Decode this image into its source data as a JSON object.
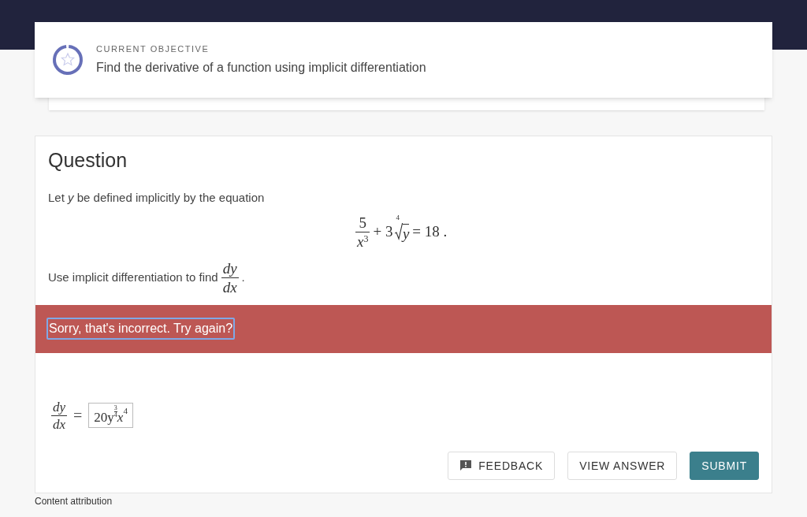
{
  "objective": {
    "label": "CURRENT OBJECTIVE",
    "text": "Find the derivative of a function using implicit differentiation"
  },
  "question": {
    "title": "Question",
    "intro": "Let *y* be defined implicitly by the equation",
    "equation": {
      "numerator": "5",
      "denominator": "*x*$^{3}$",
      "plus": "+ 3",
      "root_index": "4",
      "radicand": "y",
      "rest": "= 18 ."
    },
    "prompt": "Use implicit differentiation to find",
    "prompt_fraction": {
      "numerator": "dy",
      "denominator": "dx"
    },
    "prompt_end": "."
  },
  "feedback": {
    "message": "Sorry, that's incorrect. Try again?",
    "correct": false
  },
  "answer": {
    "lhs": {
      "numerator": "dy",
      "denominator": "dx"
    },
    "equals": "=",
    "value": {
      "base": "20y",
      "exp_numerator": "3",
      "exp_denominator": "4",
      "variable": "x",
      "power": "4"
    }
  },
  "buttons": [
    {
      "label": "FEEDBACK",
      "kind": "feedback"
    },
    {
      "label": "VIEW ANSWER",
      "kind": "secondary"
    },
    {
      "label": "SUBMIT",
      "kind": "primary"
    }
  ],
  "footer": {
    "link": "Content attribution"
  }
}
